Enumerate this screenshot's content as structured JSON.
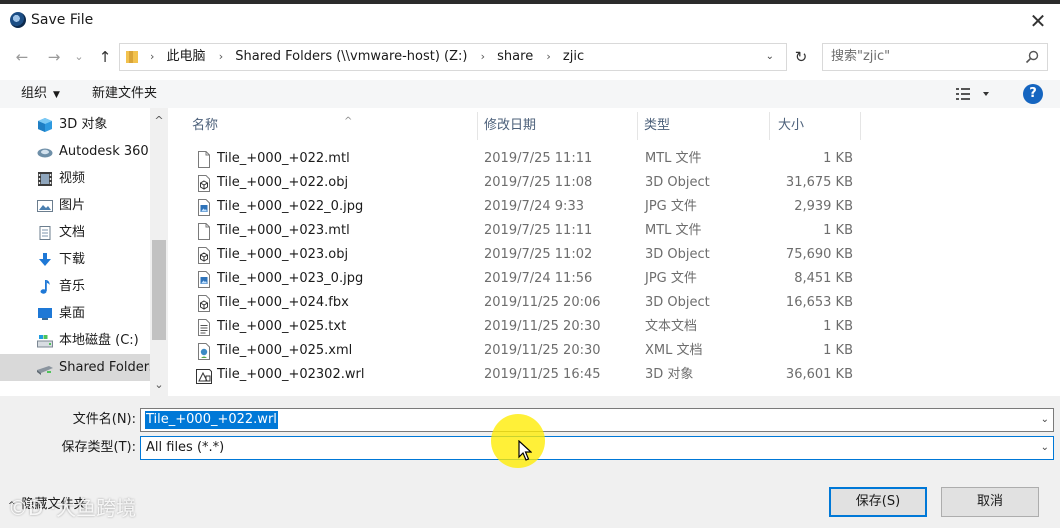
{
  "window": {
    "title": "Save File",
    "close_glyph": "✕"
  },
  "nav": {
    "back_glyph": "←",
    "forward_glyph": "→",
    "recent_glyph": "⌄",
    "up_glyph": "↑"
  },
  "address": {
    "crumbs": [
      "此电脑",
      "Shared Folders (\\\\vmware-host) (Z:)",
      "share",
      "zjic"
    ],
    "separator": "›",
    "dropdown_glyph": "⌄",
    "refresh_glyph": "↻"
  },
  "search": {
    "placeholder": "搜索\"zjic\""
  },
  "toolbar": {
    "organize": "组织",
    "organize_caret": "▼",
    "new_folder": "新建文件夹",
    "help": "?"
  },
  "sidebar": {
    "items": [
      {
        "label": "3D 对象",
        "icon": "3d-objects-icon"
      },
      {
        "label": "Autodesk 360",
        "icon": "cloud-drive-icon"
      },
      {
        "label": "视频",
        "icon": "videos-icon"
      },
      {
        "label": "图片",
        "icon": "pictures-icon"
      },
      {
        "label": "文档",
        "icon": "documents-icon"
      },
      {
        "label": "下载",
        "icon": "downloads-icon"
      },
      {
        "label": "音乐",
        "icon": "music-icon"
      },
      {
        "label": "桌面",
        "icon": "desktop-icon"
      },
      {
        "label": "本地磁盘 (C:)",
        "icon": "local-disk-icon"
      },
      {
        "label": "Shared Folders",
        "icon": "network-drive-icon",
        "selected": true
      }
    ],
    "scroll_up_glyph": "^",
    "scroll_down_glyph": "⌄"
  },
  "columns": {
    "name": "名称",
    "date": "修改日期",
    "type": "类型",
    "size": "大小",
    "sort_glyph": "^"
  },
  "files": [
    {
      "name": "Tile_+000_+022.mtl",
      "date": "2019/7/25 11:11",
      "type": "MTL 文件",
      "size": "1 KB",
      "icon": "generic-file-icon"
    },
    {
      "name": "Tile_+000_+022.obj",
      "date": "2019/7/25 11:08",
      "type": "3D Object",
      "size": "31,675 KB",
      "icon": "3d-object-file-icon"
    },
    {
      "name": "Tile_+000_+022_0.jpg",
      "date": "2019/7/24 9:33",
      "type": "JPG 文件",
      "size": "2,939 KB",
      "icon": "image-file-icon"
    },
    {
      "name": "Tile_+000_+023.mtl",
      "date": "2019/7/25 11:11",
      "type": "MTL 文件",
      "size": "1 KB",
      "icon": "generic-file-icon"
    },
    {
      "name": "Tile_+000_+023.obj",
      "date": "2019/7/25 11:02",
      "type": "3D Object",
      "size": "75,690 KB",
      "icon": "3d-object-file-icon"
    },
    {
      "name": "Tile_+000_+023_0.jpg",
      "date": "2019/7/24 11:56",
      "type": "JPG 文件",
      "size": "8,451 KB",
      "icon": "image-file-icon"
    },
    {
      "name": "Tile_+000_+024.fbx",
      "date": "2019/11/25 20:06",
      "type": "3D Object",
      "size": "16,653 KB",
      "icon": "3d-object-file-icon"
    },
    {
      "name": "Tile_+000_+025.txt",
      "date": "2019/11/25 20:30",
      "type": "文本文档",
      "size": "1 KB",
      "icon": "text-file-icon"
    },
    {
      "name": "Tile_+000_+025.xml",
      "date": "2019/11/25 20:30",
      "type": "XML 文档",
      "size": "1 KB",
      "icon": "xml-file-icon"
    },
    {
      "name": "Tile_+000_+02302.wrl",
      "date": "2019/11/25 16:45",
      "type": "3D 对象",
      "size": "36,601 KB",
      "icon": "wrl-file-icon"
    }
  ],
  "form": {
    "filename_label": "文件名(N):",
    "filename_value": "Tile_+000_+022.wrl",
    "filetype_label": "保存类型(T):",
    "filetype_value": "All files (*.*)",
    "dropdown_glyph": "⌄"
  },
  "footer": {
    "hide_folders": "隐藏文件夹",
    "hide_caret": "^",
    "save": "保存(S)",
    "cancel": "取消",
    "watermark": "©D ·大鱼跨境"
  },
  "colors": {
    "accent": "#0078d7",
    "help": "#1565c0",
    "cursor_highlight": "#ffec00",
    "folder": "#f2c24e"
  }
}
